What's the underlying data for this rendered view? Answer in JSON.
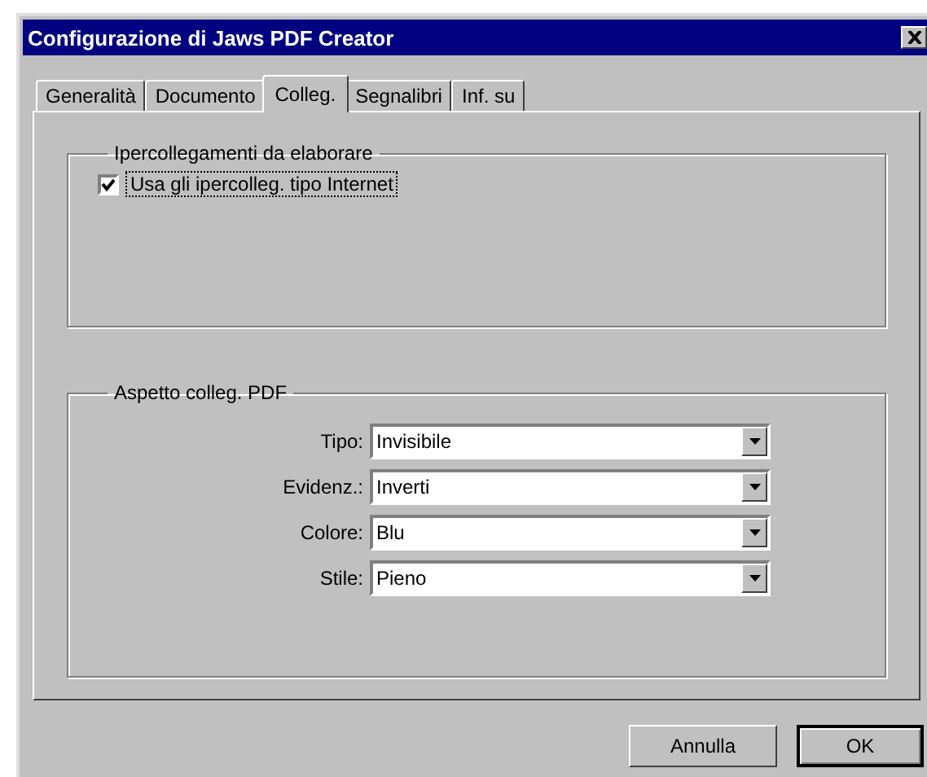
{
  "window": {
    "title": "Configurazione di Jaws PDF Creator"
  },
  "tabs": [
    {
      "label": "Generalità",
      "selected": false
    },
    {
      "label": "Documento",
      "selected": false
    },
    {
      "label": "Colleg.",
      "selected": true
    },
    {
      "label": "Segnalibri",
      "selected": false
    },
    {
      "label": "Inf. su",
      "selected": false
    }
  ],
  "hyperlinks_group": {
    "title": "Ipercollegamenti da elaborare",
    "checkbox": {
      "label": "Usa gli ipercolleg. tipo Internet",
      "checked": true
    }
  },
  "appearance_group": {
    "title": "Aspetto colleg. PDF",
    "fields": [
      {
        "label": "Tipo:",
        "value": "Invisibile"
      },
      {
        "label": "Evidenz.:",
        "value": "Inverti"
      },
      {
        "label": "Colore:",
        "value": "Blu"
      },
      {
        "label": "Stile:",
        "value": "Pieno"
      }
    ]
  },
  "buttons": [
    {
      "label": "Annulla",
      "default": false
    },
    {
      "label": "OK",
      "default": true
    }
  ]
}
